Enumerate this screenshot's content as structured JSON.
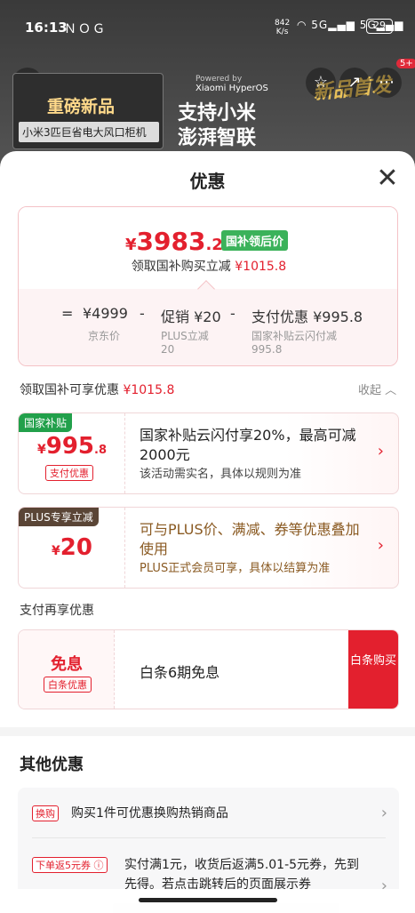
{
  "status_bar": {
    "time": "16:13",
    "net_speed": "842",
    "net_unit": "K/s",
    "battery": "29"
  },
  "hero": {
    "left_title": "重磅新品",
    "left_subtitle": "小米3匹巨省电大风口柜机",
    "powered_by": "Powered by",
    "os_name": "Xiaomi HyperOS",
    "mid_title_1": "支持小米",
    "mid_title_2": "澎湃智联",
    "new_tag": "新品首发",
    "badge_count": "5+"
  },
  "sheet": {
    "title": "优惠",
    "summary": {
      "price_symbol": "¥",
      "price_int": "3983",
      "price_dec": ".2",
      "price_badge": "国补领后价",
      "line2_prefix": "领取国补购买立减",
      "line2_amount": "¥1015.8",
      "eq_sign": "=",
      "jd_price": "¥4999",
      "minus1": "-",
      "promo_label": "促销",
      "promo_amount": "¥20",
      "minus2": "-",
      "pay_label": "支付优惠",
      "pay_amount": "¥995.8",
      "jd_price_label": "京东价",
      "plus_label": "PLUS立减",
      "plus_value": "20",
      "subsidy_label": "国家补贴云闪付减",
      "subsidy_value": "995.8"
    },
    "section_label": "领取国补可享优惠",
    "section_amount": "¥1015.8",
    "collapse_label": "收起",
    "promos": [
      {
        "tag": "国家补贴",
        "tag_color": "#22a04b",
        "symbol": "¥",
        "amount": "995",
        "decimal": ".8",
        "chip": "支付优惠",
        "main": "国家补贴云闪付享20%，最高可减2000元",
        "note": "该活动需实名，具体以规则为准"
      },
      {
        "tag": "PLUS专享立减",
        "tag_color": "#5a4536",
        "symbol": "¥",
        "amount": "20",
        "decimal": "",
        "chip": "",
        "main": "可与PLUS价、满减、券等优惠叠加使用",
        "note": "PLUS正式会员可享，具体以结算为准"
      }
    ],
    "pay_more_title": "支付再享优惠",
    "baitiao": {
      "title": "免息",
      "chip": "白条优惠",
      "text": "白条6期免息",
      "button": "白条购买"
    },
    "other_title": "其他优惠",
    "other_items": [
      {
        "tag": "换购",
        "text": "购买1件可优惠换购热销商品"
      },
      {
        "tag": "下单返5元券",
        "text": "实付满1元，收货后返满5.01-5元券，先到先得。若点击跳转后的页面展示券"
      }
    ]
  }
}
